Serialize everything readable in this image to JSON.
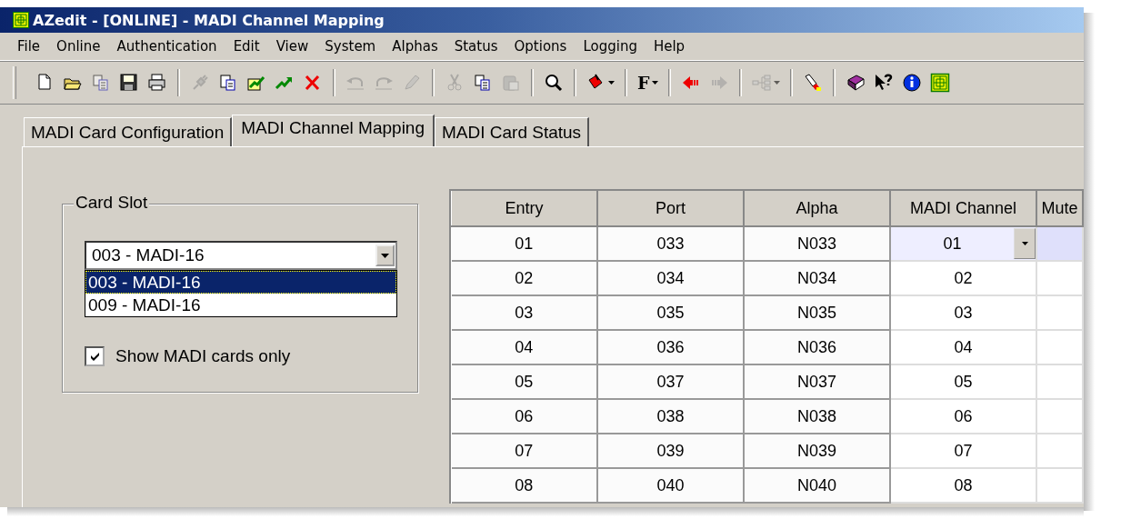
{
  "window": {
    "title": "AZedit - [ONLINE] - MADI Channel Mapping"
  },
  "menu": [
    {
      "label": "File"
    },
    {
      "label": "Online"
    },
    {
      "label": "Authentication"
    },
    {
      "label": "Edit"
    },
    {
      "label": "View"
    },
    {
      "label": "System"
    },
    {
      "label": "Alphas"
    },
    {
      "label": "Status"
    },
    {
      "label": "Options"
    },
    {
      "label": "Logging"
    },
    {
      "label": "Help"
    }
  ],
  "toolbar": [
    {
      "kind": "new",
      "disabled": false
    },
    {
      "kind": "open",
      "disabled": false
    },
    {
      "kind": "copy",
      "disabled": true
    },
    {
      "kind": "save",
      "disabled": false
    },
    {
      "kind": "print",
      "disabled": false
    },
    {
      "kind": "separator"
    },
    {
      "kind": "connect",
      "disabled": true
    },
    {
      "kind": "clipboard",
      "disabled": false
    },
    {
      "kind": "export",
      "disabled": false
    },
    {
      "kind": "upload",
      "disabled": false
    },
    {
      "kind": "delete",
      "disabled": false
    },
    {
      "kind": "separator"
    },
    {
      "kind": "undo",
      "disabled": true
    },
    {
      "kind": "redo",
      "disabled": true
    },
    {
      "kind": "pen",
      "disabled": true
    },
    {
      "kind": "separator"
    },
    {
      "kind": "cut",
      "disabled": true
    },
    {
      "kind": "copy",
      "disabled": false
    },
    {
      "kind": "paste",
      "disabled": true
    },
    {
      "kind": "separator"
    },
    {
      "kind": "find",
      "disabled": false
    },
    {
      "kind": "separator"
    },
    {
      "kind": "fill",
      "disabled": false
    },
    {
      "kind": "separator"
    },
    {
      "kind": "font",
      "label": "F",
      "disabled": false
    },
    {
      "kind": "separator"
    },
    {
      "kind": "back",
      "disabled": false
    },
    {
      "kind": "forward",
      "disabled": true
    },
    {
      "kind": "separator"
    },
    {
      "kind": "network",
      "disabled": true
    },
    {
      "kind": "separator"
    },
    {
      "kind": "flashlight",
      "disabled": false
    },
    {
      "kind": "separator"
    },
    {
      "kind": "book",
      "disabled": false
    },
    {
      "kind": "whatsthis",
      "disabled": false
    },
    {
      "kind": "info",
      "disabled": false
    },
    {
      "kind": "logo",
      "disabled": false
    }
  ],
  "tabs": [
    {
      "label": "MADI Card Configuration",
      "selected": false
    },
    {
      "label": "MADI Channel Mapping",
      "selected": true
    },
    {
      "label": "MADI Card Status",
      "selected": false
    }
  ],
  "card_slot": {
    "title": "Card Slot",
    "value": "003  -  MADI-16",
    "options": [
      {
        "label": "003  -  MADI-16",
        "selected": true
      },
      {
        "label": "009  -  MADI-16",
        "selected": false
      }
    ],
    "show_madi_only": {
      "label": "Show MADI cards only",
      "checked": true
    }
  },
  "table": {
    "columns": [
      "Entry",
      "Port",
      "Alpha",
      "MADI Channel",
      "Mute"
    ],
    "rows": [
      {
        "entry": "01",
        "port": "033",
        "alpha": "N033",
        "madi_channel": "01",
        "selected": true
      },
      {
        "entry": "02",
        "port": "034",
        "alpha": "N034",
        "madi_channel": "02",
        "selected": false
      },
      {
        "entry": "03",
        "port": "035",
        "alpha": "N035",
        "madi_channel": "03",
        "selected": false
      },
      {
        "entry": "04",
        "port": "036",
        "alpha": "N036",
        "madi_channel": "04",
        "selected": false
      },
      {
        "entry": "05",
        "port": "037",
        "alpha": "N037",
        "madi_channel": "05",
        "selected": false
      },
      {
        "entry": "06",
        "port": "038",
        "alpha": "N038",
        "madi_channel": "06",
        "selected": false
      },
      {
        "entry": "07",
        "port": "039",
        "alpha": "N039",
        "madi_channel": "07",
        "selected": false
      },
      {
        "entry": "08",
        "port": "040",
        "alpha": "N040",
        "madi_channel": "08",
        "selected": false
      }
    ]
  }
}
